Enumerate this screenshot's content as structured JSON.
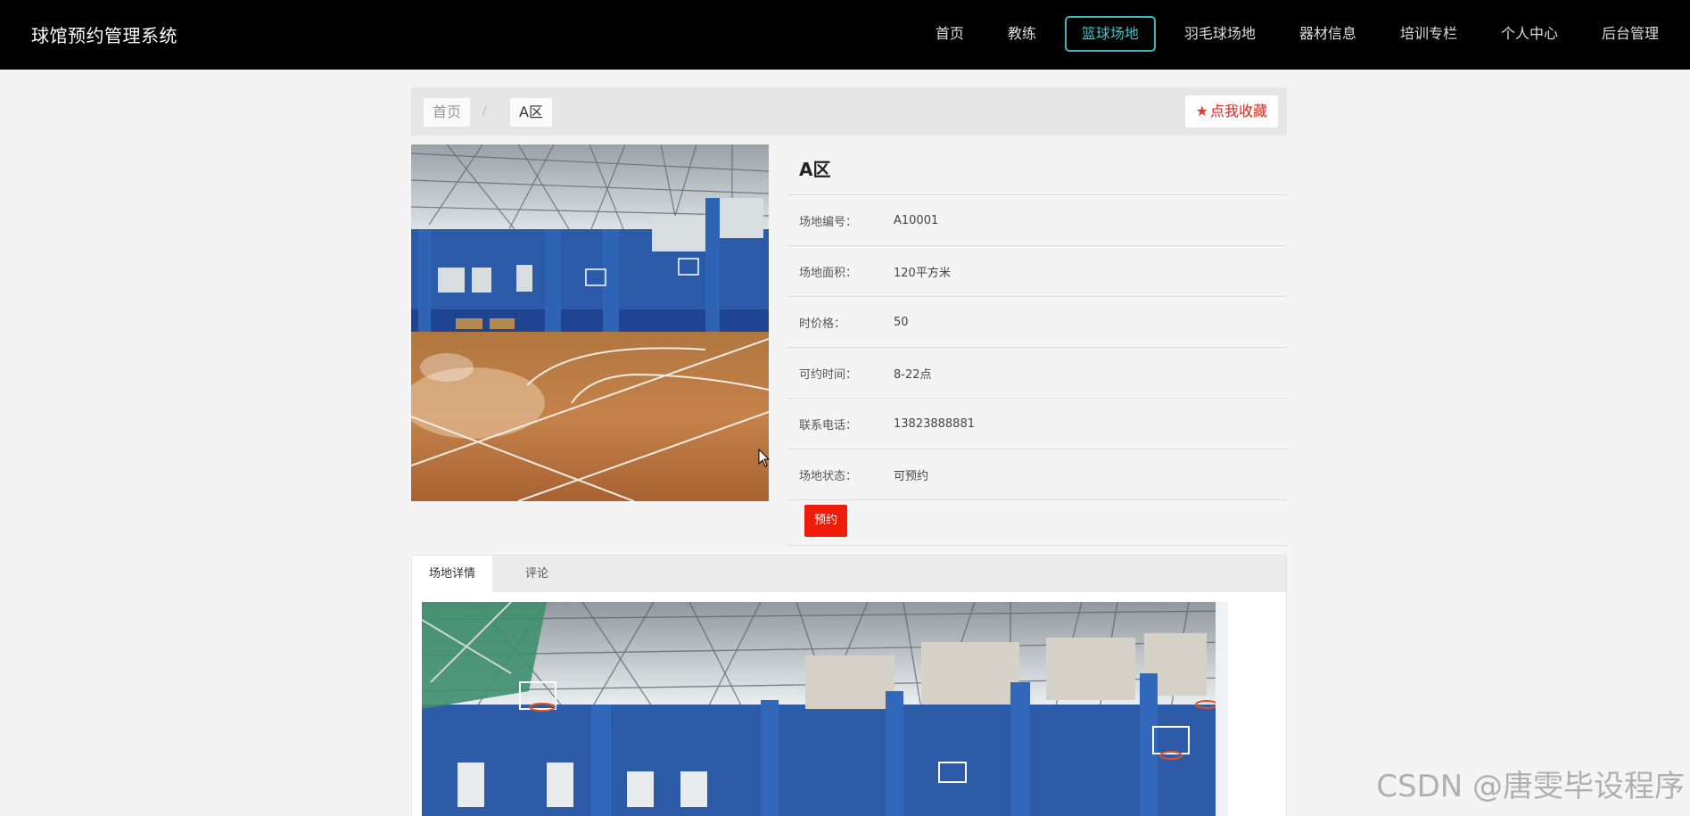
{
  "header": {
    "brand": "球馆预约管理系统",
    "nav": [
      {
        "label": "首页"
      },
      {
        "label": "教练"
      },
      {
        "label": "篮球场地",
        "active": true
      },
      {
        "label": "羽毛球场地"
      },
      {
        "label": "器材信息"
      },
      {
        "label": "培训专栏"
      },
      {
        "label": "个人中心"
      },
      {
        "label": "后台管理"
      }
    ]
  },
  "breadcrumb": {
    "home": "首页",
    "separator": "/",
    "current": "A区"
  },
  "favorite": {
    "label": "点我收藏",
    "icon": "star-icon"
  },
  "venue": {
    "title": "A区",
    "fields": [
      {
        "label": "场地编号：",
        "value": "A10001"
      },
      {
        "label": "场地面积：",
        "value": "120平方米"
      },
      {
        "label": "时价格：",
        "value": "50"
      },
      {
        "label": "可约时间：",
        "value": "8-22点"
      },
      {
        "label": "联系电话：",
        "value": "13823888881"
      },
      {
        "label": "场地状态：",
        "value": "可预约"
      }
    ],
    "book_label": "预约"
  },
  "tabs": [
    {
      "label": "场地详情",
      "active": true
    },
    {
      "label": "评论"
    }
  ],
  "watermark": "CSDN @唐雯毕设程序",
  "colors": {
    "accent": "#3bb6bd",
    "book_button": "#ee1c0b",
    "favorite_text": "#d9261c"
  }
}
